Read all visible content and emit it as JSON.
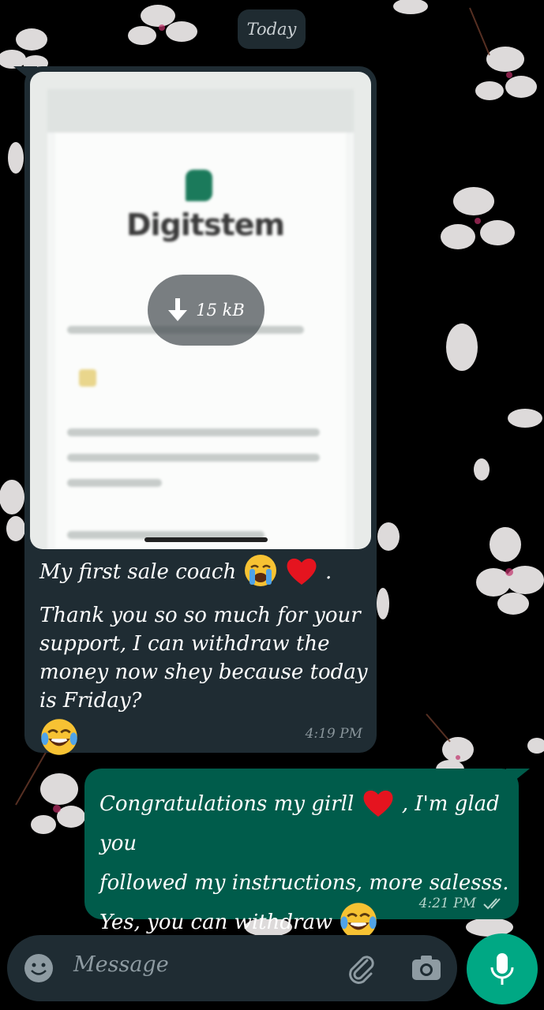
{
  "date_chip": "Today",
  "incoming": {
    "document_preview": {
      "brand_text": "Digitstem",
      "download_size": "15 kB"
    },
    "line1": "My first sale coach",
    "line1_suffix": ".",
    "line2": "Thank you so so much for your support, I can withdraw the money now shey because today is Friday?",
    "time": "4:19 PM"
  },
  "outgoing": {
    "line1_start": "Congratulations my girll",
    "line1_end": ", I'm glad you",
    "line2": "followed my instructions, more salesss.",
    "line3": "Yes, you can withdraw",
    "time": "4:21 PM",
    "status": "delivered"
  },
  "composer": {
    "placeholder": "Message"
  },
  "colors": {
    "incoming_bubble": "#1f2c33",
    "outgoing_bubble": "#005c4b",
    "mic_button": "#00a884",
    "background": "#000000"
  },
  "icons": [
    "emoji-icon",
    "attach-icon",
    "camera-icon",
    "mic-icon",
    "download-arrow-icon",
    "double-check-icon"
  ]
}
